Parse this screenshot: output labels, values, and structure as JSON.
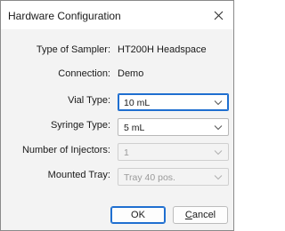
{
  "window": {
    "title": "Hardware Configuration"
  },
  "fields": {
    "sampler_type": {
      "label": "Type of Sampler:",
      "value": "HT200H Headspace"
    },
    "connection": {
      "label": "Connection:",
      "value": "Demo"
    },
    "vial_type": {
      "label": "Vial Type:",
      "value": "10 mL",
      "enabled": true
    },
    "syringe_type": {
      "label": "Syringe Type:",
      "value": "5 mL",
      "enabled": true
    },
    "num_injectors": {
      "label": "Number of Injectors:",
      "value": "1",
      "enabled": false
    },
    "mounted_tray": {
      "label": "Mounted Tray:",
      "value": "Tray 40 pos.",
      "enabled": false
    }
  },
  "buttons": {
    "ok": "OK",
    "cancel_prefix": "",
    "cancel_mnemonic": "C",
    "cancel_rest": "ancel"
  },
  "icons": {
    "close": "close-icon",
    "dropdown": "chevron-down-icon"
  },
  "colors": {
    "accent": "#1f6fd0",
    "dialog_bg": "#f3f3f3"
  }
}
